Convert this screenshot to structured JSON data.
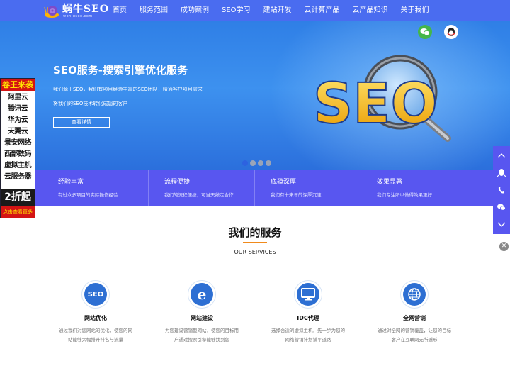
{
  "logo": {
    "text": "蜗牛SEO",
    "sub": "woniuseo.com"
  },
  "nav": {
    "items": [
      "首页",
      "服务范围",
      "成功案例",
      "SEO学习",
      "建站开发",
      "云计算产品",
      "云产品知识",
      "关于我们"
    ]
  },
  "banner": {
    "title": "SEO服务-搜索引擎优化服务",
    "desc1": "我们源于SEO，我们有项目经验丰富的SEO团队，精通客户项目需求",
    "desc2": "将我们的SEO技术转化成您的客户",
    "button": "查看详情",
    "art_text": "SEO",
    "slides": 4,
    "active_slide": 1
  },
  "features": [
    {
      "title": "经验丰富",
      "desc": "有过众多项目的实际操作经验"
    },
    {
      "title": "流程便捷",
      "desc": "我们的流程便捷，可当天敲定合作"
    },
    {
      "title": "底蕴深厚",
      "desc": "我们有十来年的深厚沉淀"
    },
    {
      "title": "效果显著",
      "desc": "我们专注所以做得效果更好"
    }
  ],
  "left_ad": {
    "top": "卷王来袭",
    "items": [
      "阿里云",
      "腾讯云",
      "华为云",
      "天翼云",
      "景安网络",
      "西部数码",
      "虚拟主机",
      "云服务器"
    ],
    "sale": "2折起",
    "bottom": "点击查看更多"
  },
  "services": {
    "title": "我们的服务",
    "subtitle": "OUR SERVICES",
    "items": [
      {
        "icon": "seo-icon",
        "icon_text": "SEO",
        "name": "网站优化",
        "desc": "通过我们对您网站的优化，使您的网站能够大幅排升排名与流量"
      },
      {
        "icon": "ie-browser-icon",
        "icon_text": "e",
        "name": "网站建设",
        "desc": "为您建设营销型网站，使您的目标用户通过搜索引擎能够找到您"
      },
      {
        "icon": "monitor-icon",
        "icon_text": "",
        "name": "IDC代理",
        "desc": "选择合适的虚拟主机，先一步为您的网络营销计划铺平道路"
      },
      {
        "icon": "globe-icon",
        "icon_text": "",
        "name": "全网营销",
        "desc": "通过对全网的营销覆盖，让您的目标客户在互联网无所遁形"
      }
    ]
  },
  "colors": {
    "nav": "#4a6cf0",
    "features": "#5856f0",
    "accent": "#f08a1c",
    "icon_blue": "#2d6fd3"
  }
}
